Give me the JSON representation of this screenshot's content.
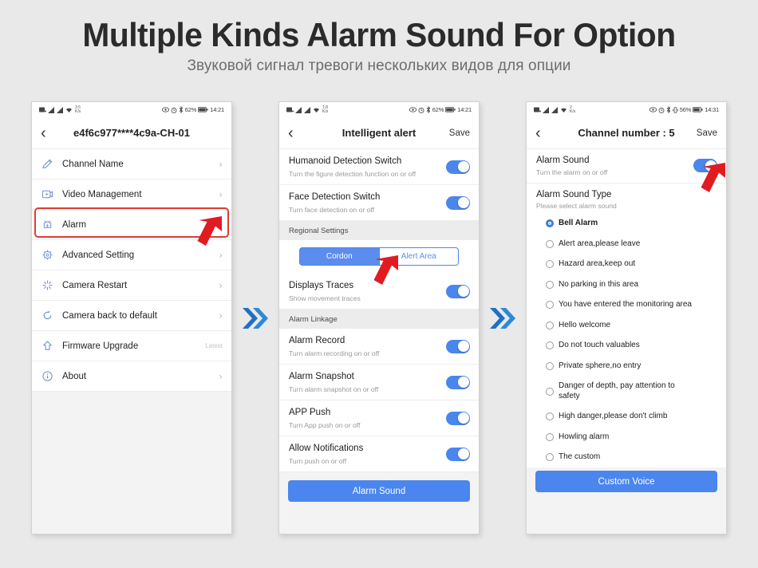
{
  "header": {
    "title": "Multiple Kinds Alarm Sound For Option",
    "subtitle": "Звуковой сигнал тревоги нескольких видов для опции"
  },
  "colors": {
    "accent_blue": "#4a86ed",
    "segment_blue": "#5b8def",
    "radio_selected": "#3b7ddd",
    "highlight_red": "#e03c31",
    "arrow_blue": "#2575c8",
    "page_bg": "#e9e9e9",
    "section_header_bg": "#ececec"
  },
  "separator": {
    "icon": "double-chevron-right-icon"
  },
  "screen1": {
    "statusbar": {
      "icons_left": [
        "sim-icon",
        "signal-icon",
        "signal-icon",
        "wifi-icon"
      ],
      "rate_value": "3.5",
      "rate_unit": "K/s",
      "icons_right": [
        "eye-icon",
        "alarm-clock-icon",
        "bluetooth-icon"
      ],
      "battery_percent": "62%",
      "battery_icon": "battery-icon",
      "time": "14:21"
    },
    "nav": {
      "back_icon": "chevron-left-icon",
      "title": "e4f6c977****4c9a-CH-01",
      "save_label": ""
    },
    "menu": [
      {
        "icon": "pencil-icon",
        "label": "Channel Name",
        "note": "",
        "chevron": "›",
        "highlighted": false
      },
      {
        "icon": "video-icon",
        "label": "Video Management",
        "note": "",
        "chevron": "›",
        "highlighted": false
      },
      {
        "icon": "alarm-bell-icon",
        "label": "Alarm",
        "note": "",
        "chevron": "›",
        "highlighted": true
      },
      {
        "icon": "gear-icon",
        "label": "Advanced Setting",
        "note": "",
        "chevron": "›",
        "highlighted": false
      },
      {
        "icon": "restart-icon",
        "label": "Camera Restart",
        "note": "",
        "chevron": "›",
        "highlighted": false
      },
      {
        "icon": "refresh-icon",
        "label": "Camera back to default",
        "note": "",
        "chevron": "›",
        "highlighted": false
      },
      {
        "icon": "upload-arrow-icon",
        "label": "Firmware Upgrade",
        "note": "Latest",
        "chevron": "",
        "highlighted": false
      },
      {
        "icon": "info-icon",
        "label": "About",
        "note": "",
        "chevron": "›",
        "highlighted": false
      }
    ]
  },
  "screen2": {
    "statusbar": {
      "rate_value": "1.8",
      "rate_unit": "K/s",
      "battery_percent": "62%",
      "time": "14:21"
    },
    "nav": {
      "back_icon": "chevron-left-icon",
      "title": "Intelligent alert",
      "save_label": "Save"
    },
    "rows_top": [
      {
        "title": "Humanoid Detection Switch",
        "sub": "Turn the figure detection function on or off",
        "toggle": true
      },
      {
        "title": "Face Detection Switch",
        "sub": "Turn face detection on or off",
        "toggle": true
      }
    ],
    "regional_header": "Regional Settings",
    "segments": [
      {
        "label": "Cordon",
        "active": true
      },
      {
        "label": "Alert Area",
        "active": false
      }
    ],
    "traces_row": {
      "title": "Displays Traces",
      "sub": "Show movement traces",
      "toggle": true
    },
    "linkage_header": "Alarm Linkage",
    "rows_linkage": [
      {
        "title": "Alarm Record",
        "sub": "Turn alarm recording on or off",
        "toggle": true
      },
      {
        "title": "Alarm Snapshot",
        "sub": "Turn alarm snapshot on or off",
        "toggle": true
      },
      {
        "title": "APP Push",
        "sub": "Turn App push on or off",
        "toggle": true
      },
      {
        "title": "Allow Notifications",
        "sub": "Turn push on or off",
        "toggle": true
      }
    ],
    "bottom_button": "Alarm Sound"
  },
  "screen3": {
    "statusbar": {
      "rate_value": "2",
      "rate_unit": "K/s",
      "battery_percent": "56%",
      "time": "14:31"
    },
    "nav": {
      "back_icon": "chevron-left-icon",
      "title": "Channel number : 5",
      "save_label": "Save"
    },
    "alarm_sound_row": {
      "title": "Alarm Sound",
      "sub": "Turn the alarm on or off",
      "toggle": true
    },
    "type_block": {
      "title": "Alarm Sound Type",
      "sub": "Please select alarm sound"
    },
    "options": [
      {
        "label": "Bell Alarm",
        "selected": true
      },
      {
        "label": "Alert area,please leave",
        "selected": false
      },
      {
        "label": "Hazard area,keep out",
        "selected": false
      },
      {
        "label": "No parking in this area",
        "selected": false
      },
      {
        "label": "You have entered the monitoring area",
        "selected": false
      },
      {
        "label": "Hello welcome",
        "selected": false
      },
      {
        "label": "Do not touch valuables",
        "selected": false
      },
      {
        "label": "Private sphere,no entry",
        "selected": false
      },
      {
        "label": "Danger of depth, pay attention to safety",
        "selected": false
      },
      {
        "label": "High danger,please don't climb",
        "selected": false
      },
      {
        "label": "Howling alarm",
        "selected": false
      },
      {
        "label": "The custom",
        "selected": false
      }
    ],
    "bottom_button": "Custom Voice"
  }
}
